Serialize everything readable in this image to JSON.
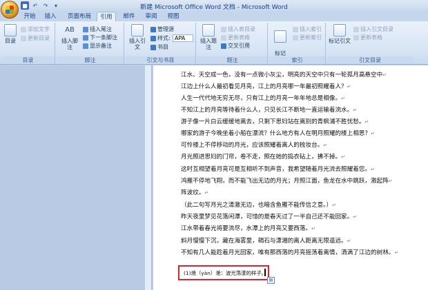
{
  "window": {
    "title": "新建 Microsoft Office Word 文档 - Microsoft Word"
  },
  "quick_access": {
    "save": "save-icon",
    "undo": "↶",
    "redo": "↷",
    "customize": "▾"
  },
  "tabs": [
    {
      "label": "开始"
    },
    {
      "label": "插入"
    },
    {
      "label": "页面布局"
    },
    {
      "label": "引用"
    },
    {
      "label": "邮件"
    },
    {
      "label": "审阅"
    },
    {
      "label": "视图"
    }
  ],
  "ribbon": {
    "toc_group": {
      "label": "目录",
      "toc_button": "目录",
      "add_text": "添加文字",
      "update_toc": "更新目录"
    },
    "footnote_group": {
      "label": "脚注",
      "insert_footnote": "插入脚注",
      "insert_endnote": "插入尾注",
      "next_footnote": "下一条脚注",
      "show_notes": "显示备注",
      "ab_glyph": "AB"
    },
    "citation_group": {
      "label": "引文与书目",
      "insert_citation": "插入引文",
      "manage_sources": "管理源",
      "style_label": "样式:",
      "style_value": "APA",
      "bibliography": "书目"
    },
    "caption_group": {
      "label": "题注",
      "insert_caption": "插入题注",
      "insert_table_of_figures": "插入表目录",
      "update_table": "更新表格",
      "cross_reference": "交叉引用"
    },
    "index_group": {
      "label": "索引",
      "mark_entry": "标记\n索引项",
      "insert_index": "插入索引",
      "update_index": "更新索引"
    },
    "authorities_group": {
      "label": "引文目录",
      "mark_citation": "标记引文",
      "insert_table_of_authorities": "插入引文目录",
      "update_table": "更新表格"
    }
  },
  "document": {
    "lines": [
      "江水、天空成一色，没有一点微小灰尘，明亮的天空中只有一轮孤月高悬空中",
      "江边上什么人最初看见月亮，江上的月亮哪一年最初照耀着人？",
      "人生一代代地无穷无尽，只有江上的月亮一年年地总是相像。",
      "不知江上的月亮等待着什么人，只见长江不断地一直运输着流水。",
      "游子像一片白云缓缓地离去，只剩下思妇站在离别的青枫浦不胜忧愁。",
      "哪家的游子今晚坐着小船在漂流？什么地方有人在明月照耀的楼上相思？",
      "可怜楼上不停移动的月光，应该照耀着离人的梳妆台。",
      "月光照进思妇的门帘，卷不走，照在她的捣衣砧上，拂不掉。",
      "这时互相望着月亮可是互相听不到声音，我希望随着月光流去照耀着您。",
      "鸿雁不停地飞翔，而不能飞出无边的月光；月照江面，鱼龙在水中跳跃，激起阵",
      "阵波纹。",
      "（此二句写月光之清澈无边，也暗含鱼雁不能传信之意。）",
      "昨天夜里梦见花落闲潭，可惜的是春天过了一半自己还不能回家。",
      "江水带着春光将要流尽，水潭上的月亮又要西落。",
      "斜月慢慢下沉，藏在海雾里，碣石与潇湘的离人距离无限遥远。",
      "不知有几人能趁着月光回家，唯有那西落的月亮摇荡着离情，洒满了江边的树林。"
    ],
    "paragraph_mark": "↵",
    "footnote": "(1)滟（yàn）滟：波光荡漾的样子。"
  }
}
